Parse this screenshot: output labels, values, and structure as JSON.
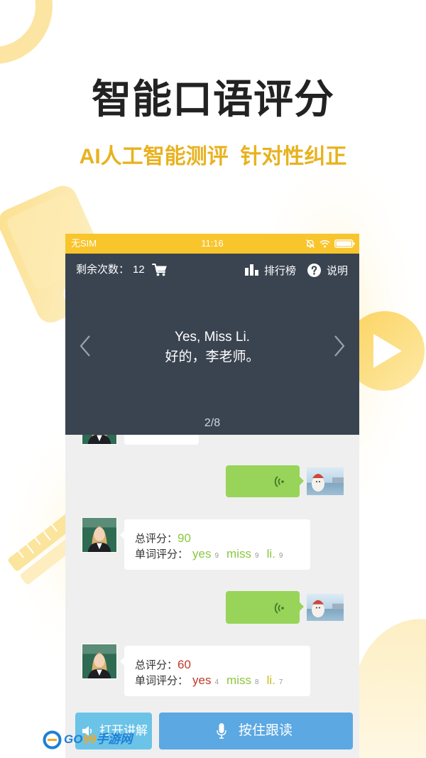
{
  "promo": {
    "title": "智能口语评分",
    "subtitle": "AI人工智能测评  针对性纠正"
  },
  "status_bar": {
    "carrier": "无SIM",
    "time": "11:16",
    "icons": [
      "alarm-off-icon",
      "wifi-icon",
      "battery-icon"
    ]
  },
  "header": {
    "remaining_label": "剩余次数：",
    "remaining_count": "12",
    "cart_icon": "cart-icon",
    "leaderboard_icon": "bar-chart-icon",
    "leaderboard_label": "排行榜",
    "help_icon": "question-circle-icon",
    "help_label": "说明"
  },
  "sentence": {
    "english": "Yes, Miss Li.",
    "chinese": "好的，李老师。",
    "progress": "2/8",
    "prev_icon": "chevron-left-icon",
    "next_icon": "chevron-right-icon"
  },
  "chat": {
    "voice_icon": "voice-wave-icon",
    "scores": [
      {
        "total_label": "总评分：",
        "total": "90",
        "total_color": "#8CC63F",
        "words_label": "单词评分：",
        "words": [
          {
            "word": "yes",
            "score": "9",
            "color": "#8CC63F"
          },
          {
            "word": "miss",
            "score": "9",
            "color": "#8CC63F"
          },
          {
            "word": "li.",
            "score": "9",
            "color": "#8CC63F"
          }
        ]
      },
      {
        "total_label": "总评分：",
        "total": "60",
        "total_color": "#C0392B",
        "words_label": "单词评分：",
        "words": [
          {
            "word": "yes",
            "score": "4",
            "color": "#C0392B"
          },
          {
            "word": "miss",
            "score": "8",
            "color": "#8CC63F"
          },
          {
            "word": "li.",
            "score": "7",
            "color": "#C8BE1E"
          }
        ]
      }
    ]
  },
  "buttons": {
    "explain_icon": "speaker-icon",
    "explain_label": "打开讲解",
    "record_icon": "microphone-icon",
    "record_label": "按住跟读"
  },
  "watermark": {
    "brand_a": "GO",
    "brand_b": "99",
    "suffix": "手游网"
  },
  "colors": {
    "status_bar": "#F8C52C",
    "panel": "#3A4350",
    "subtitle": "#E8B21F",
    "voice_bubble": "#98D45A",
    "explain_button": "#6BC3E7",
    "record_button": "#5BA8E2",
    "chat_background": "#EFEFEF"
  }
}
